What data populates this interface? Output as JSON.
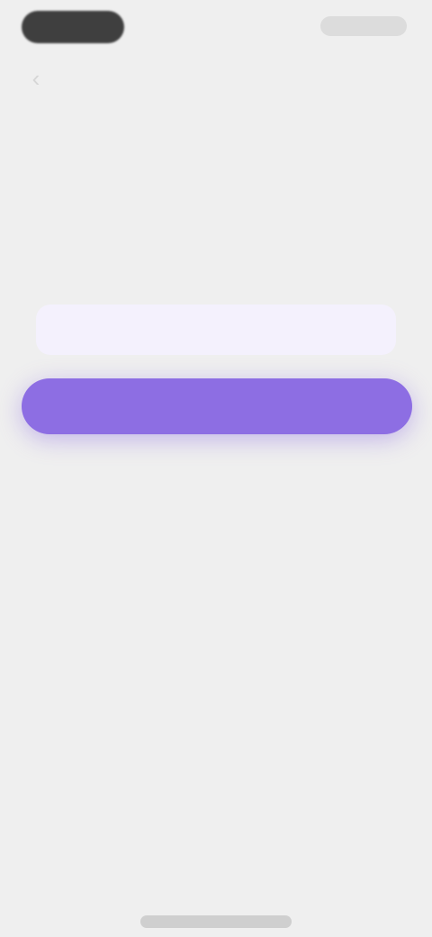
{
  "status_bar": {
    "time": "",
    "indicators": ""
  },
  "nav": {
    "back_icon": "chevron-left-icon",
    "title": ""
  },
  "header": {
    "title": "",
    "subtitle": ""
  },
  "form": {
    "input_value": "",
    "input_placeholder": "",
    "submit_label": ""
  },
  "footer": {
    "note": "",
    "link_label": ""
  },
  "colors": {
    "accent": "#8d6ee3",
    "background": "#efefef",
    "input_background": "#f4f1fd"
  }
}
